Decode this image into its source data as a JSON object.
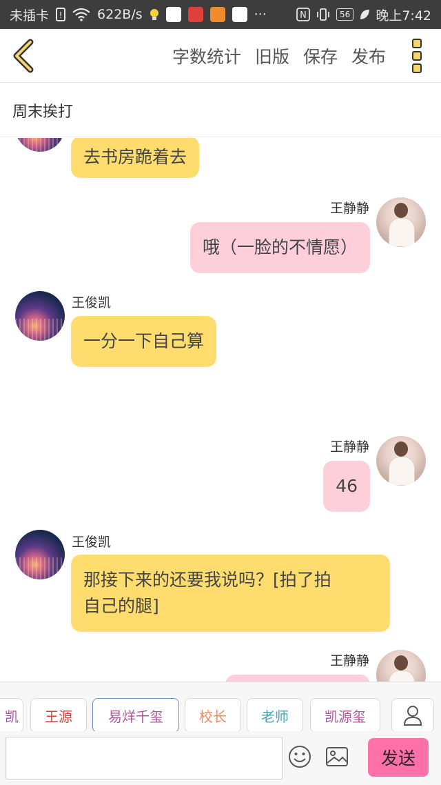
{
  "status_bar": {
    "carrier": "未插卡",
    "speed": "622B/s",
    "more": "···",
    "battery": "56",
    "time": "晚上7:42"
  },
  "header": {
    "actions": [
      "字数统计",
      "旧版",
      "保存",
      "发布"
    ]
  },
  "title": "周末挨打",
  "messages": [
    {
      "side": "left",
      "speaker": "",
      "text": "去书房跪着去"
    },
    {
      "side": "right",
      "speaker": "王静静",
      "text": "哦（一脸的不情愿）"
    },
    {
      "side": "left",
      "speaker": "王俊凯",
      "text": "一分一下自己算"
    },
    {
      "side": "right",
      "speaker": "王静静",
      "text": "46"
    },
    {
      "side": "left",
      "speaker": "王俊凯",
      "text_line1": "那接下来的还要我说吗？[拍了拍",
      "text_line2": "自己的腿]"
    },
    {
      "side": "right",
      "speaker": "王静静",
      "text": ""
    }
  ],
  "tags": [
    {
      "label": "凯",
      "color": "#b0579a"
    },
    {
      "label": "王源",
      "color": "#d9423a"
    },
    {
      "label": "易烊千玺",
      "color": "#b0579a",
      "selected": true
    },
    {
      "label": "校长",
      "color": "#ef8a60"
    },
    {
      "label": "老师",
      "color": "#4aa3b5"
    },
    {
      "label": "凯源玺",
      "color": "#b0579a"
    }
  ],
  "input": {
    "send_label": "发送",
    "placeholder": ""
  },
  "colors": {
    "left_bubble": "#fedc6e",
    "right_bubble": "#fdcfdb",
    "send_button": "#fd71a8"
  }
}
